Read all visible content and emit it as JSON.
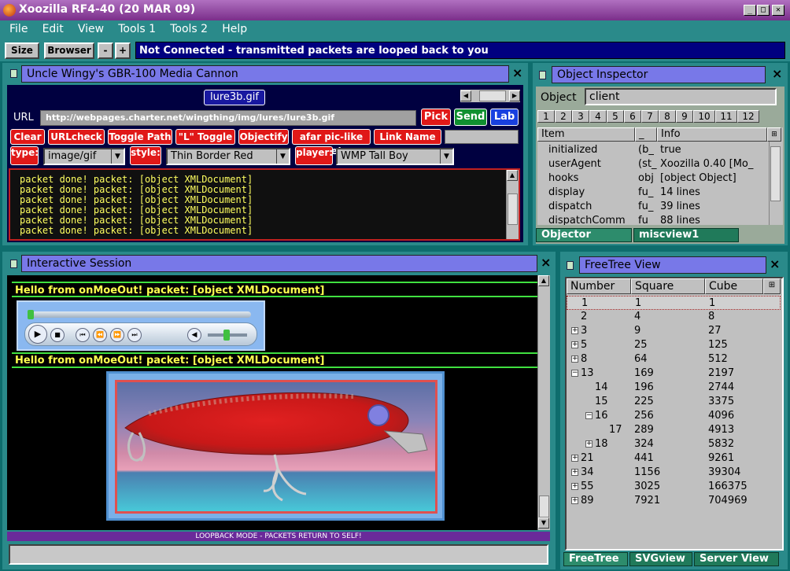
{
  "app": {
    "title": "Xoozilla RF4-40 (20 MAR 09)"
  },
  "menu": [
    "File",
    "Edit",
    "View",
    "Tools 1",
    "Tools 2",
    "Help"
  ],
  "toolbar": {
    "size_label": "Size",
    "browser_label": "Browser",
    "minus_label": "-",
    "plus_label": "+",
    "status": "Not Connected - transmitted packets are looped back to you"
  },
  "media_panel": {
    "title": "Uncle Wingy's GBR-100 Media Cannon",
    "filename": "lure3b.gif",
    "url_label": "URL",
    "url_value": "http://webpages.charter.net/wingthing/img/lures/lure3b.gif",
    "pick": "Pick",
    "send": "Send",
    "lab": "Lab",
    "buttons": [
      "Clear",
      "URLcheck",
      "Toggle Path",
      "\"L\" Toggle",
      "Objectify",
      "afar pic-like file!",
      "Link Name =>"
    ],
    "type_label": "type:",
    "type_value": "image/gif",
    "style_label": "style:",
    "style_value": "Thin Border Red",
    "player_label": "player:",
    "player_value": "WMP Tall Boy",
    "log": [
      "packet done! packet: [object XMLDocument]",
      "packet done! packet: [object XMLDocument]",
      "packet done! packet: [object XMLDocument]",
      "packet done! packet: [object XMLDocument]",
      "packet done! packet: [object XMLDocument]",
      "packet done! packet: [object XMLDocument]"
    ]
  },
  "inspector": {
    "title": "Object Inspector",
    "object_label": "Object",
    "object_value": "client",
    "tabs": [
      "1",
      "2",
      "3",
      "4",
      "5",
      "6",
      "7",
      "8",
      "9",
      "10",
      "11",
      "12"
    ],
    "col_item": "Item",
    "col_type": "_",
    "col_info": "Info",
    "rows": [
      {
        "item": "initialized",
        "type": "(b_",
        "info": "true"
      },
      {
        "item": "userAgent",
        "type": "(st_",
        "info": "Xoozilla 0.40 [Mo_"
      },
      {
        "item": "hooks",
        "type": "obj",
        "info": "[object Object]"
      },
      {
        "item": "display",
        "type": "fu_",
        "info": "14 lines"
      },
      {
        "item": "dispatch",
        "type": "fu_",
        "info": "39 lines"
      },
      {
        "item": "dispatchComm",
        "type": "fu_",
        "info": "88 lines"
      }
    ],
    "bottom_tabs": [
      "Objector",
      "miscview1"
    ]
  },
  "session": {
    "title": "Interactive Session",
    "msg1": "Hello from onMoeOut! packet: [object XMLDocument]",
    "msg2": "Hello from onMoeOut! packet: [object XMLDocument]",
    "footer": "LOOPBACK MODE - PACKETS RETURN TO SELF!"
  },
  "freetree": {
    "title": "FreeTree View",
    "cols": [
      "Number",
      "Square",
      "Cube"
    ],
    "rows": [
      {
        "n": "1",
        "s": "1",
        "c": "1",
        "indent": 0,
        "exp": ""
      },
      {
        "n": "2",
        "s": "4",
        "c": "8",
        "indent": 0,
        "exp": ""
      },
      {
        "n": "3",
        "s": "9",
        "c": "27",
        "indent": 0,
        "exp": "+"
      },
      {
        "n": "5",
        "s": "25",
        "c": "125",
        "indent": 0,
        "exp": "+"
      },
      {
        "n": "8",
        "s": "64",
        "c": "512",
        "indent": 0,
        "exp": "+"
      },
      {
        "n": "13",
        "s": "169",
        "c": "2197",
        "indent": 0,
        "exp": "−"
      },
      {
        "n": "14",
        "s": "196",
        "c": "2744",
        "indent": 1,
        "exp": ""
      },
      {
        "n": "15",
        "s": "225",
        "c": "3375",
        "indent": 1,
        "exp": ""
      },
      {
        "n": "16",
        "s": "256",
        "c": "4096",
        "indent": 1,
        "exp": "−"
      },
      {
        "n": "17",
        "s": "289",
        "c": "4913",
        "indent": 2,
        "exp": ""
      },
      {
        "n": "18",
        "s": "324",
        "c": "5832",
        "indent": 1,
        "exp": "+"
      },
      {
        "n": "21",
        "s": "441",
        "c": "9261",
        "indent": 0,
        "exp": "+"
      },
      {
        "n": "34",
        "s": "1156",
        "c": "39304",
        "indent": 0,
        "exp": "+"
      },
      {
        "n": "55",
        "s": "3025",
        "c": "166375",
        "indent": 0,
        "exp": "+"
      },
      {
        "n": "89",
        "s": "7921",
        "c": "704969",
        "indent": 0,
        "exp": "+"
      }
    ],
    "tabs": [
      "FreeTree",
      "SVGview",
      "Server View"
    ]
  },
  "colors": {
    "titlebar": "#8a3a9a",
    "panel_title": "#7878e8",
    "desktop": "#0e6d6d",
    "status_bar": "#000080"
  }
}
